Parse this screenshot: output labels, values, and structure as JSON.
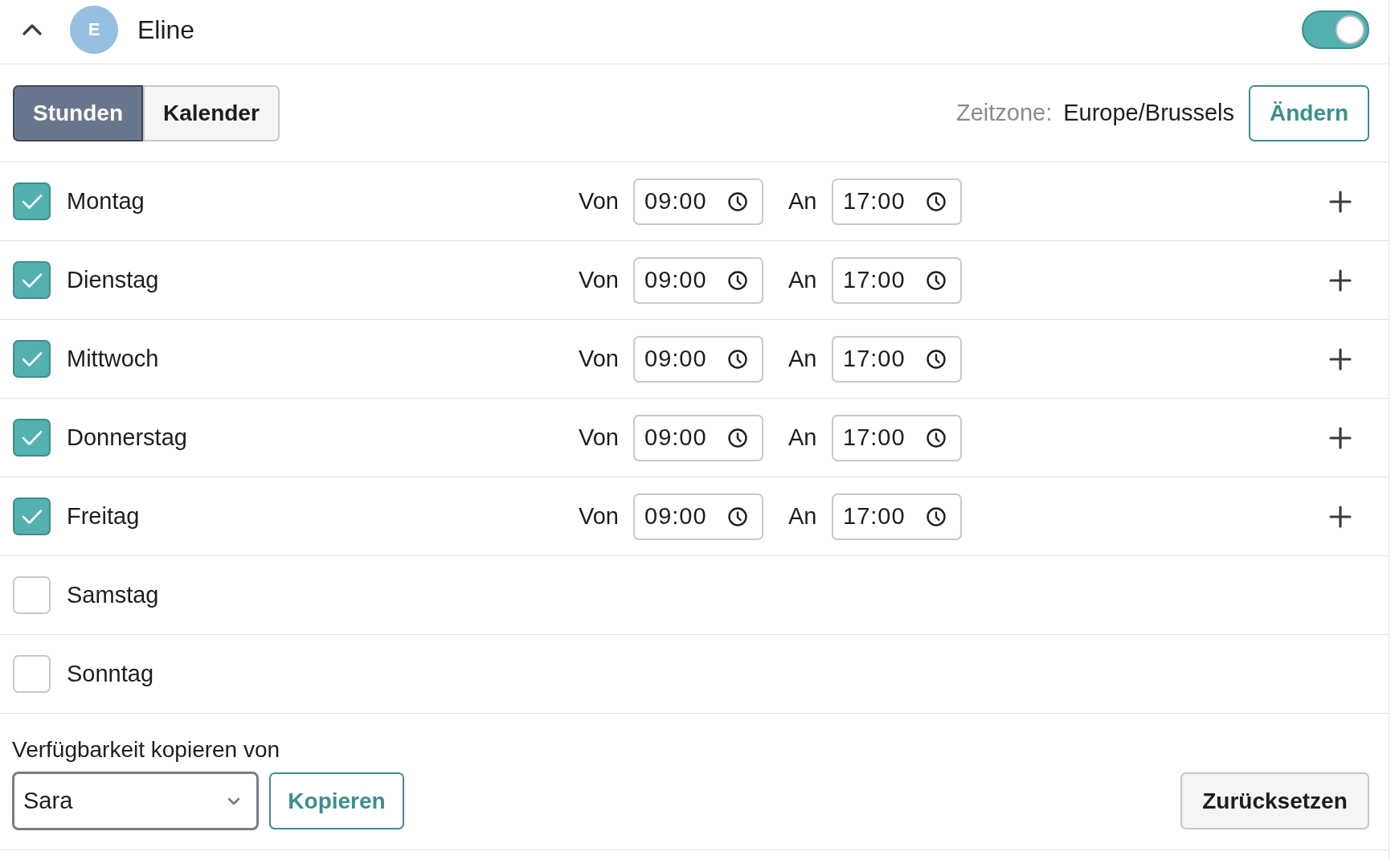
{
  "header": {
    "expanded": true,
    "avatar_initial": "E",
    "name": "Eline",
    "enabled": true
  },
  "tabs": [
    {
      "label": "Stunden",
      "selected": true
    },
    {
      "label": "Kalender",
      "selected": false
    }
  ],
  "timezone": {
    "label": "Zeitzone:",
    "value": "Europe/Brussels",
    "button": "Ändern"
  },
  "days": [
    {
      "name": "Montag",
      "checked": true,
      "from_label": "Von",
      "from": "09:00",
      "to_label": "An",
      "to": "17:00"
    },
    {
      "name": "Dienstag",
      "checked": true,
      "from_label": "Von",
      "from": "09:00",
      "to_label": "An",
      "to": "17:00"
    },
    {
      "name": "Mittwoch",
      "checked": true,
      "from_label": "Von",
      "from": "09:00",
      "to_label": "An",
      "to": "17:00"
    },
    {
      "name": "Donnerstag",
      "checked": true,
      "from_label": "Von",
      "from": "09:00",
      "to_label": "An",
      "to": "17:00"
    },
    {
      "name": "Freitag",
      "checked": true,
      "from_label": "Von",
      "from": "09:00",
      "to_label": "An",
      "to": "17:00"
    },
    {
      "name": "Samstag",
      "checked": false
    },
    {
      "name": "Sonntag",
      "checked": false
    }
  ],
  "copy": {
    "label": "Verfügbarkeit kopieren von",
    "select_value": "Sara",
    "button": "Kopieren"
  },
  "reset_button": "Zurücksetzen"
}
